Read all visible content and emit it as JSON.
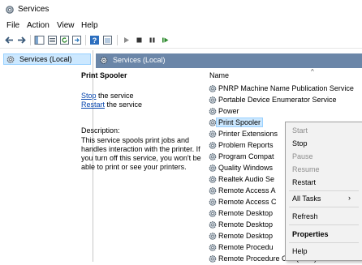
{
  "window": {
    "title": "Services"
  },
  "menu": [
    "File",
    "Action",
    "View",
    "Help"
  ],
  "tree": {
    "item": "Services (Local)"
  },
  "panel": {
    "header": "Services (Local)"
  },
  "detail": {
    "service_name": "Print Spooler",
    "stop_link": "Stop",
    "stop_suffix": " the service",
    "restart_link": "Restart",
    "restart_suffix": " the service",
    "description_label": "Description:",
    "description": "This service spools print jobs and handles interaction with the printer. If you turn off this service, you won't be able to print or see your printers."
  },
  "list": {
    "column_name": "Name",
    "sort_caret": "^",
    "rows": [
      "PNRP Machine Name Publication Service",
      "Portable Device Enumerator Service",
      "Power",
      "Print Spooler",
      "Printer Extensions",
      "Problem Reports",
      "Program Compat",
      "Quality Windows",
      "Realtek Audio Se",
      "Remote Access A",
      "Remote Access C",
      "Remote Desktop",
      "Remote Desktop",
      "Remote Desktop",
      "Remote Procedu",
      "Remote Procedure Call (RPC) Locator"
    ],
    "selected_index": 3
  },
  "context_menu": {
    "start": "Start",
    "stop": "Stop",
    "pause": "Pause",
    "resume": "Resume",
    "restart": "Restart",
    "all_tasks": "All Tasks",
    "all_tasks_arrow": "›",
    "refresh": "Refresh",
    "properties": "Properties",
    "help": "Help"
  },
  "colors": {
    "panel_header": "#6b86a8",
    "selection": "#cce8ff",
    "link": "#0645ad"
  }
}
